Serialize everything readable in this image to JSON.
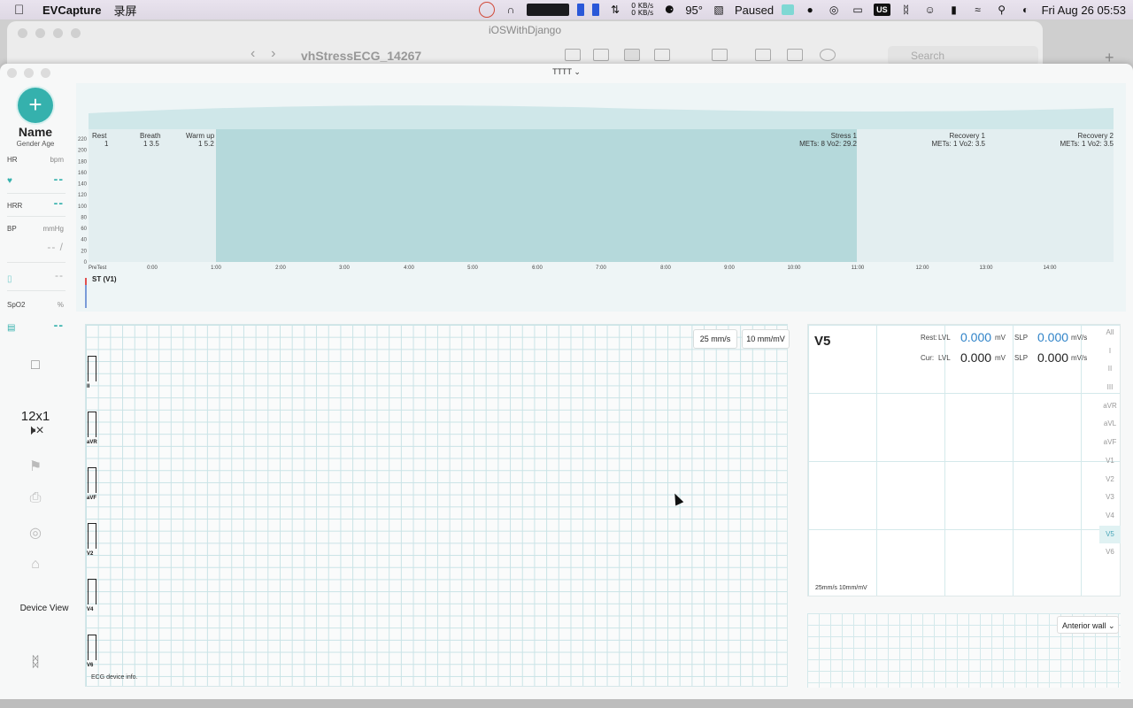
{
  "menubar": {
    "app_name": "EVCapture",
    "menu_item": "录屏",
    "net_up": "0 KB/s",
    "net_down": "0 KB/s",
    "temperature": "95°",
    "paused_label": "Paused",
    "input_badge": "US",
    "datetime": "Fri Aug 26  05:53"
  },
  "bg_window": {
    "title": "iOSWithDjango",
    "document": "vhStressECG_14267",
    "search_placeholder": "Search"
  },
  "app_window": {
    "title": "TTTT"
  },
  "sidebar": {
    "patient_name": "Name",
    "patient_sub": "Gender Age",
    "hr_label": "HR",
    "hr_unit": "bpm",
    "hr_value": "--",
    "hrr_label": "HRR",
    "hrr_value": "--",
    "bp_label": "BP",
    "bp_unit": "mmHg",
    "bp_value": "-- /",
    "spo2_label": "SpO2",
    "spo2_unit": "%",
    "spo2_extra_value": "--",
    "spo2_value": "--",
    "display_mode": "12x1",
    "device_view": "Device View"
  },
  "trend": {
    "stages": [
      {
        "name": "Rest",
        "line2": "1"
      },
      {
        "name": "Breath",
        "line2": "1  3.5"
      },
      {
        "name": "Warm up",
        "line2": "1  5.2"
      },
      {
        "name": "Stress 1",
        "line2": "METs: 8  Vo2: 29.2"
      },
      {
        "name": "Recovery 1",
        "line2": "METs: 1  Vo2: 3.5"
      },
      {
        "name": "Recovery 2",
        "line2": "METs: 1  Vo2: 3.5"
      }
    ],
    "y_ticks": [
      "220",
      "200",
      "180",
      "160",
      "140",
      "120",
      "100",
      "80",
      "60",
      "40",
      "20",
      "0"
    ],
    "x_ticks": [
      "PreTest",
      "0:00",
      "1:00",
      "2:00",
      "3:00",
      "4:00",
      "5:00",
      "6:00",
      "7:00",
      "8:00",
      "9:00",
      "10:00",
      "11:00",
      "12:00",
      "13:00",
      "14:00"
    ],
    "st_label": "ST (V1)"
  },
  "ecg": {
    "speed_button": "25 mm/s",
    "gain_button": "10 mm/mV",
    "leads": [
      "II",
      "aVR",
      "aVF",
      "V2",
      "V4",
      "V6"
    ],
    "device_info": "ECG device info."
  },
  "st_panel": {
    "lead": "V5",
    "rest_label": "Rest:",
    "cur_label": "Cur:",
    "lvl": "LVL",
    "slp": "SLP",
    "rest_lvl": "0.000",
    "rest_slp": "0.000",
    "cur_lvl": "0.000",
    "cur_slp": "0.000",
    "mv_unit": "mV",
    "mvs_unit": "mV/s",
    "scale": "25mm/s  10mm/mV",
    "lead_options": [
      "All",
      "I",
      "II",
      "III",
      "aVR",
      "aVL",
      "aVF",
      "V1",
      "V2",
      "V3",
      "V4",
      "V5",
      "V6"
    ],
    "selected_lead": "V5"
  },
  "wall_select": {
    "value": "Anterior wall"
  },
  "colors": {
    "accent": "#35b1ad",
    "grid": "#c9e3e6",
    "stress_fill": "#a9d3d6",
    "value_blue": "#2f83c8"
  }
}
